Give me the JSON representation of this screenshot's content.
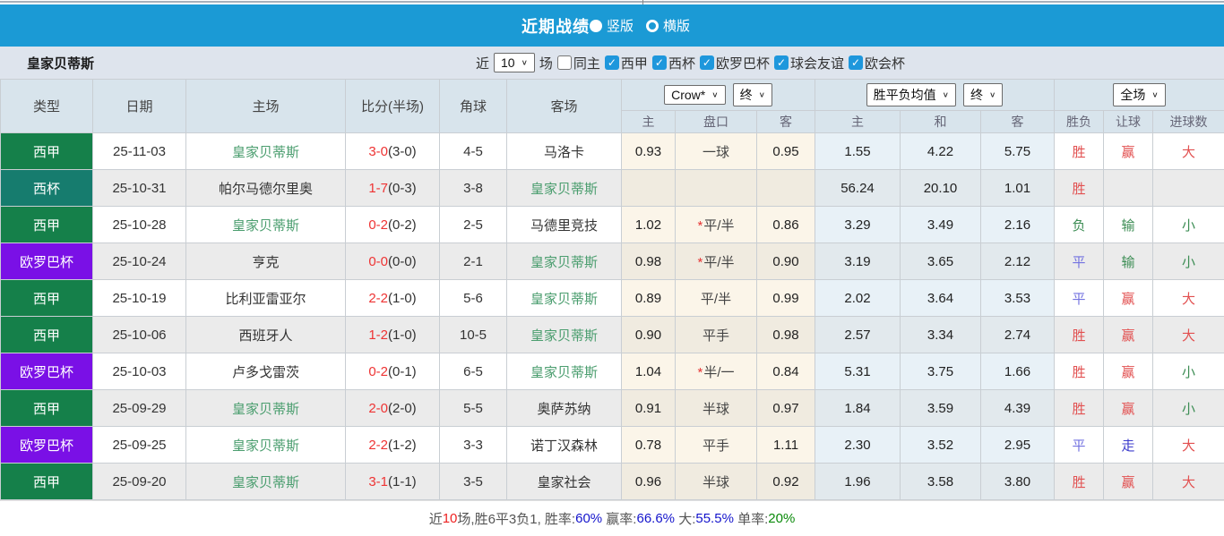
{
  "colors": {
    "accent_blue": "#1b9ad5",
    "check_blue": "#1e97dc",
    "type_liga": "#15804a",
    "type_copa": "#167c6e",
    "type_europa": "#7a10e6",
    "team_green": "#4a9d6e",
    "score_red": "#ee3333",
    "score_half": "#333333",
    "red": "#e25050",
    "green": "#3c8d54",
    "blue": "#7372e0",
    "blue2": "#3c3ccc",
    "summary_grey": "#555555",
    "summary_red": "#ee2222",
    "summary_blue": "#1414cc",
    "summary_green": "#0a8a0a"
  },
  "title_bar": {
    "title": "近期战绩",
    "radio_options": [
      {
        "label": "竖版",
        "selected": true
      },
      {
        "label": "横版",
        "selected": false
      }
    ]
  },
  "filter_bar": {
    "team_name": "皇家贝蒂斯",
    "near_label": "近",
    "matches_count": "10",
    "matches_label": "场",
    "checkboxes": [
      {
        "label": "同主",
        "checked": false
      },
      {
        "label": "西甲",
        "checked": true
      },
      {
        "label": "西杯",
        "checked": true
      },
      {
        "label": "欧罗巴杯",
        "checked": true
      },
      {
        "label": "球会友谊",
        "checked": true
      },
      {
        "label": "欧会杯",
        "checked": true
      }
    ]
  },
  "table": {
    "main_headers": [
      "类型",
      "日期",
      "主场",
      "比分(半场)",
      "角球",
      "客场"
    ],
    "selects": {
      "odds_source": "Crow*",
      "odds_time": "终",
      "avg_source": "胜平负均值",
      "avg_time": "终",
      "scope": "全场"
    },
    "sub_headers": [
      "主",
      "盘口",
      "客",
      "主",
      "和",
      "客",
      "胜负",
      "让球",
      "进球数"
    ],
    "rows": [
      {
        "type": "西甲",
        "type_key": "liga",
        "date": "25-11-03",
        "home": "皇家贝蒂斯",
        "home_team": true,
        "score": "3-0",
        "half": "(3-0)",
        "corner": "4-5",
        "away": "马洛卡",
        "away_team": false,
        "o_home": "0.93",
        "handicap": "一球",
        "star": false,
        "o_away": "0.95",
        "a_home": "1.55",
        "a_draw": "4.22",
        "a_away": "5.75",
        "result": "胜",
        "result_c": "red",
        "let": "赢",
        "let_c": "red",
        "goal": "大",
        "goal_c": "red"
      },
      {
        "type": "西杯",
        "type_key": "copa",
        "date": "25-10-31",
        "home": "帕尔马德尔里奥",
        "home_team": false,
        "score": "1-7",
        "half": "(0-3)",
        "corner": "3-8",
        "away": "皇家贝蒂斯",
        "away_team": true,
        "o_home": "",
        "handicap": "",
        "star": false,
        "o_away": "",
        "a_home": "56.24",
        "a_draw": "20.10",
        "a_away": "1.01",
        "result": "胜",
        "result_c": "red",
        "let": "",
        "let_c": "",
        "goal": "",
        "goal_c": ""
      },
      {
        "type": "西甲",
        "type_key": "liga",
        "date": "25-10-28",
        "home": "皇家贝蒂斯",
        "home_team": true,
        "score": "0-2",
        "half": "(0-2)",
        "corner": "2-5",
        "away": "马德里竞技",
        "away_team": false,
        "o_home": "1.02",
        "handicap": "平/半",
        "star": true,
        "o_away": "0.86",
        "a_home": "3.29",
        "a_draw": "3.49",
        "a_away": "2.16",
        "result": "负",
        "result_c": "green",
        "let": "输",
        "let_c": "green",
        "goal": "小",
        "goal_c": "green"
      },
      {
        "type": "欧罗巴杯",
        "type_key": "europa",
        "date": "25-10-24",
        "home": "亨克",
        "home_team": false,
        "score": "0-0",
        "half": "(0-0)",
        "corner": "2-1",
        "away": "皇家贝蒂斯",
        "away_team": true,
        "o_home": "0.98",
        "handicap": "平/半",
        "star": true,
        "o_away": "0.90",
        "a_home": "3.19",
        "a_draw": "3.65",
        "a_away": "2.12",
        "result": "平",
        "result_c": "blue",
        "let": "输",
        "let_c": "green",
        "goal": "小",
        "goal_c": "green"
      },
      {
        "type": "西甲",
        "type_key": "liga",
        "date": "25-10-19",
        "home": "比利亚雷亚尔",
        "home_team": false,
        "score": "2-2",
        "half": "(1-0)",
        "corner": "5-6",
        "away": "皇家贝蒂斯",
        "away_team": true,
        "o_home": "0.89",
        "handicap": "平/半",
        "star": false,
        "o_away": "0.99",
        "a_home": "2.02",
        "a_draw": "3.64",
        "a_away": "3.53",
        "result": "平",
        "result_c": "blue",
        "let": "赢",
        "let_c": "red",
        "goal": "大",
        "goal_c": "red"
      },
      {
        "type": "西甲",
        "type_key": "liga",
        "date": "25-10-06",
        "home": "西班牙人",
        "home_team": false,
        "score": "1-2",
        "half": "(1-0)",
        "corner": "10-5",
        "away": "皇家贝蒂斯",
        "away_team": true,
        "o_home": "0.90",
        "handicap": "平手",
        "star": false,
        "o_away": "0.98",
        "a_home": "2.57",
        "a_draw": "3.34",
        "a_away": "2.74",
        "result": "胜",
        "result_c": "red",
        "let": "赢",
        "let_c": "red",
        "goal": "大",
        "goal_c": "red"
      },
      {
        "type": "欧罗巴杯",
        "type_key": "europa",
        "date": "25-10-03",
        "home": "卢多戈雷茨",
        "home_team": false,
        "score": "0-2",
        "half": "(0-1)",
        "corner": "6-5",
        "away": "皇家贝蒂斯",
        "away_team": true,
        "o_home": "1.04",
        "handicap": "半/一",
        "star": true,
        "o_away": "0.84",
        "a_home": "5.31",
        "a_draw": "3.75",
        "a_away": "1.66",
        "result": "胜",
        "result_c": "red",
        "let": "赢",
        "let_c": "red",
        "goal": "小",
        "goal_c": "green"
      },
      {
        "type": "西甲",
        "type_key": "liga",
        "date": "25-09-29",
        "home": "皇家贝蒂斯",
        "home_team": true,
        "score": "2-0",
        "half": "(2-0)",
        "corner": "5-5",
        "away": "奥萨苏纳",
        "away_team": false,
        "o_home": "0.91",
        "handicap": "半球",
        "star": false,
        "o_away": "0.97",
        "a_home": "1.84",
        "a_draw": "3.59",
        "a_away": "4.39",
        "result": "胜",
        "result_c": "red",
        "let": "赢",
        "let_c": "red",
        "goal": "小",
        "goal_c": "green"
      },
      {
        "type": "欧罗巴杯",
        "type_key": "europa",
        "date": "25-09-25",
        "home": "皇家贝蒂斯",
        "home_team": true,
        "score": "2-2",
        "half": "(1-2)",
        "corner": "3-3",
        "away": "诺丁汉森林",
        "away_team": false,
        "o_home": "0.78",
        "handicap": "平手",
        "star": false,
        "o_away": "1.11",
        "a_home": "2.30",
        "a_draw": "3.52",
        "a_away": "2.95",
        "result": "平",
        "result_c": "blue",
        "let": "走",
        "let_c": "blue2",
        "goal": "大",
        "goal_c": "red"
      },
      {
        "type": "西甲",
        "type_key": "liga",
        "date": "25-09-20",
        "home": "皇家贝蒂斯",
        "home_team": true,
        "score": "3-1",
        "half": "(1-1)",
        "corner": "3-5",
        "away": "皇家社会",
        "away_team": false,
        "o_home": "0.96",
        "handicap": "半球",
        "star": false,
        "o_away": "0.92",
        "a_home": "1.96",
        "a_draw": "3.58",
        "a_away": "3.80",
        "result": "胜",
        "result_c": "red",
        "let": "赢",
        "let_c": "red",
        "goal": "大",
        "goal_c": "red"
      }
    ]
  },
  "summary": {
    "segments": [
      {
        "text": "近",
        "color_key": "summary_grey"
      },
      {
        "text": "10",
        "color_key": "summary_red"
      },
      {
        "text": "场,胜6平3负1, 胜率:",
        "color_key": "summary_grey"
      },
      {
        "text": "60%",
        "color_key": "summary_blue"
      },
      {
        "text": " 赢率:",
        "color_key": "summary_grey"
      },
      {
        "text": "66.6%",
        "color_key": "summary_blue"
      },
      {
        "text": " 大:",
        "color_key": "summary_grey"
      },
      {
        "text": "55.5%",
        "color_key": "summary_blue"
      },
      {
        "text": " 单率:",
        "color_key": "summary_grey"
      },
      {
        "text": "20%",
        "color_key": "summary_green"
      }
    ]
  }
}
